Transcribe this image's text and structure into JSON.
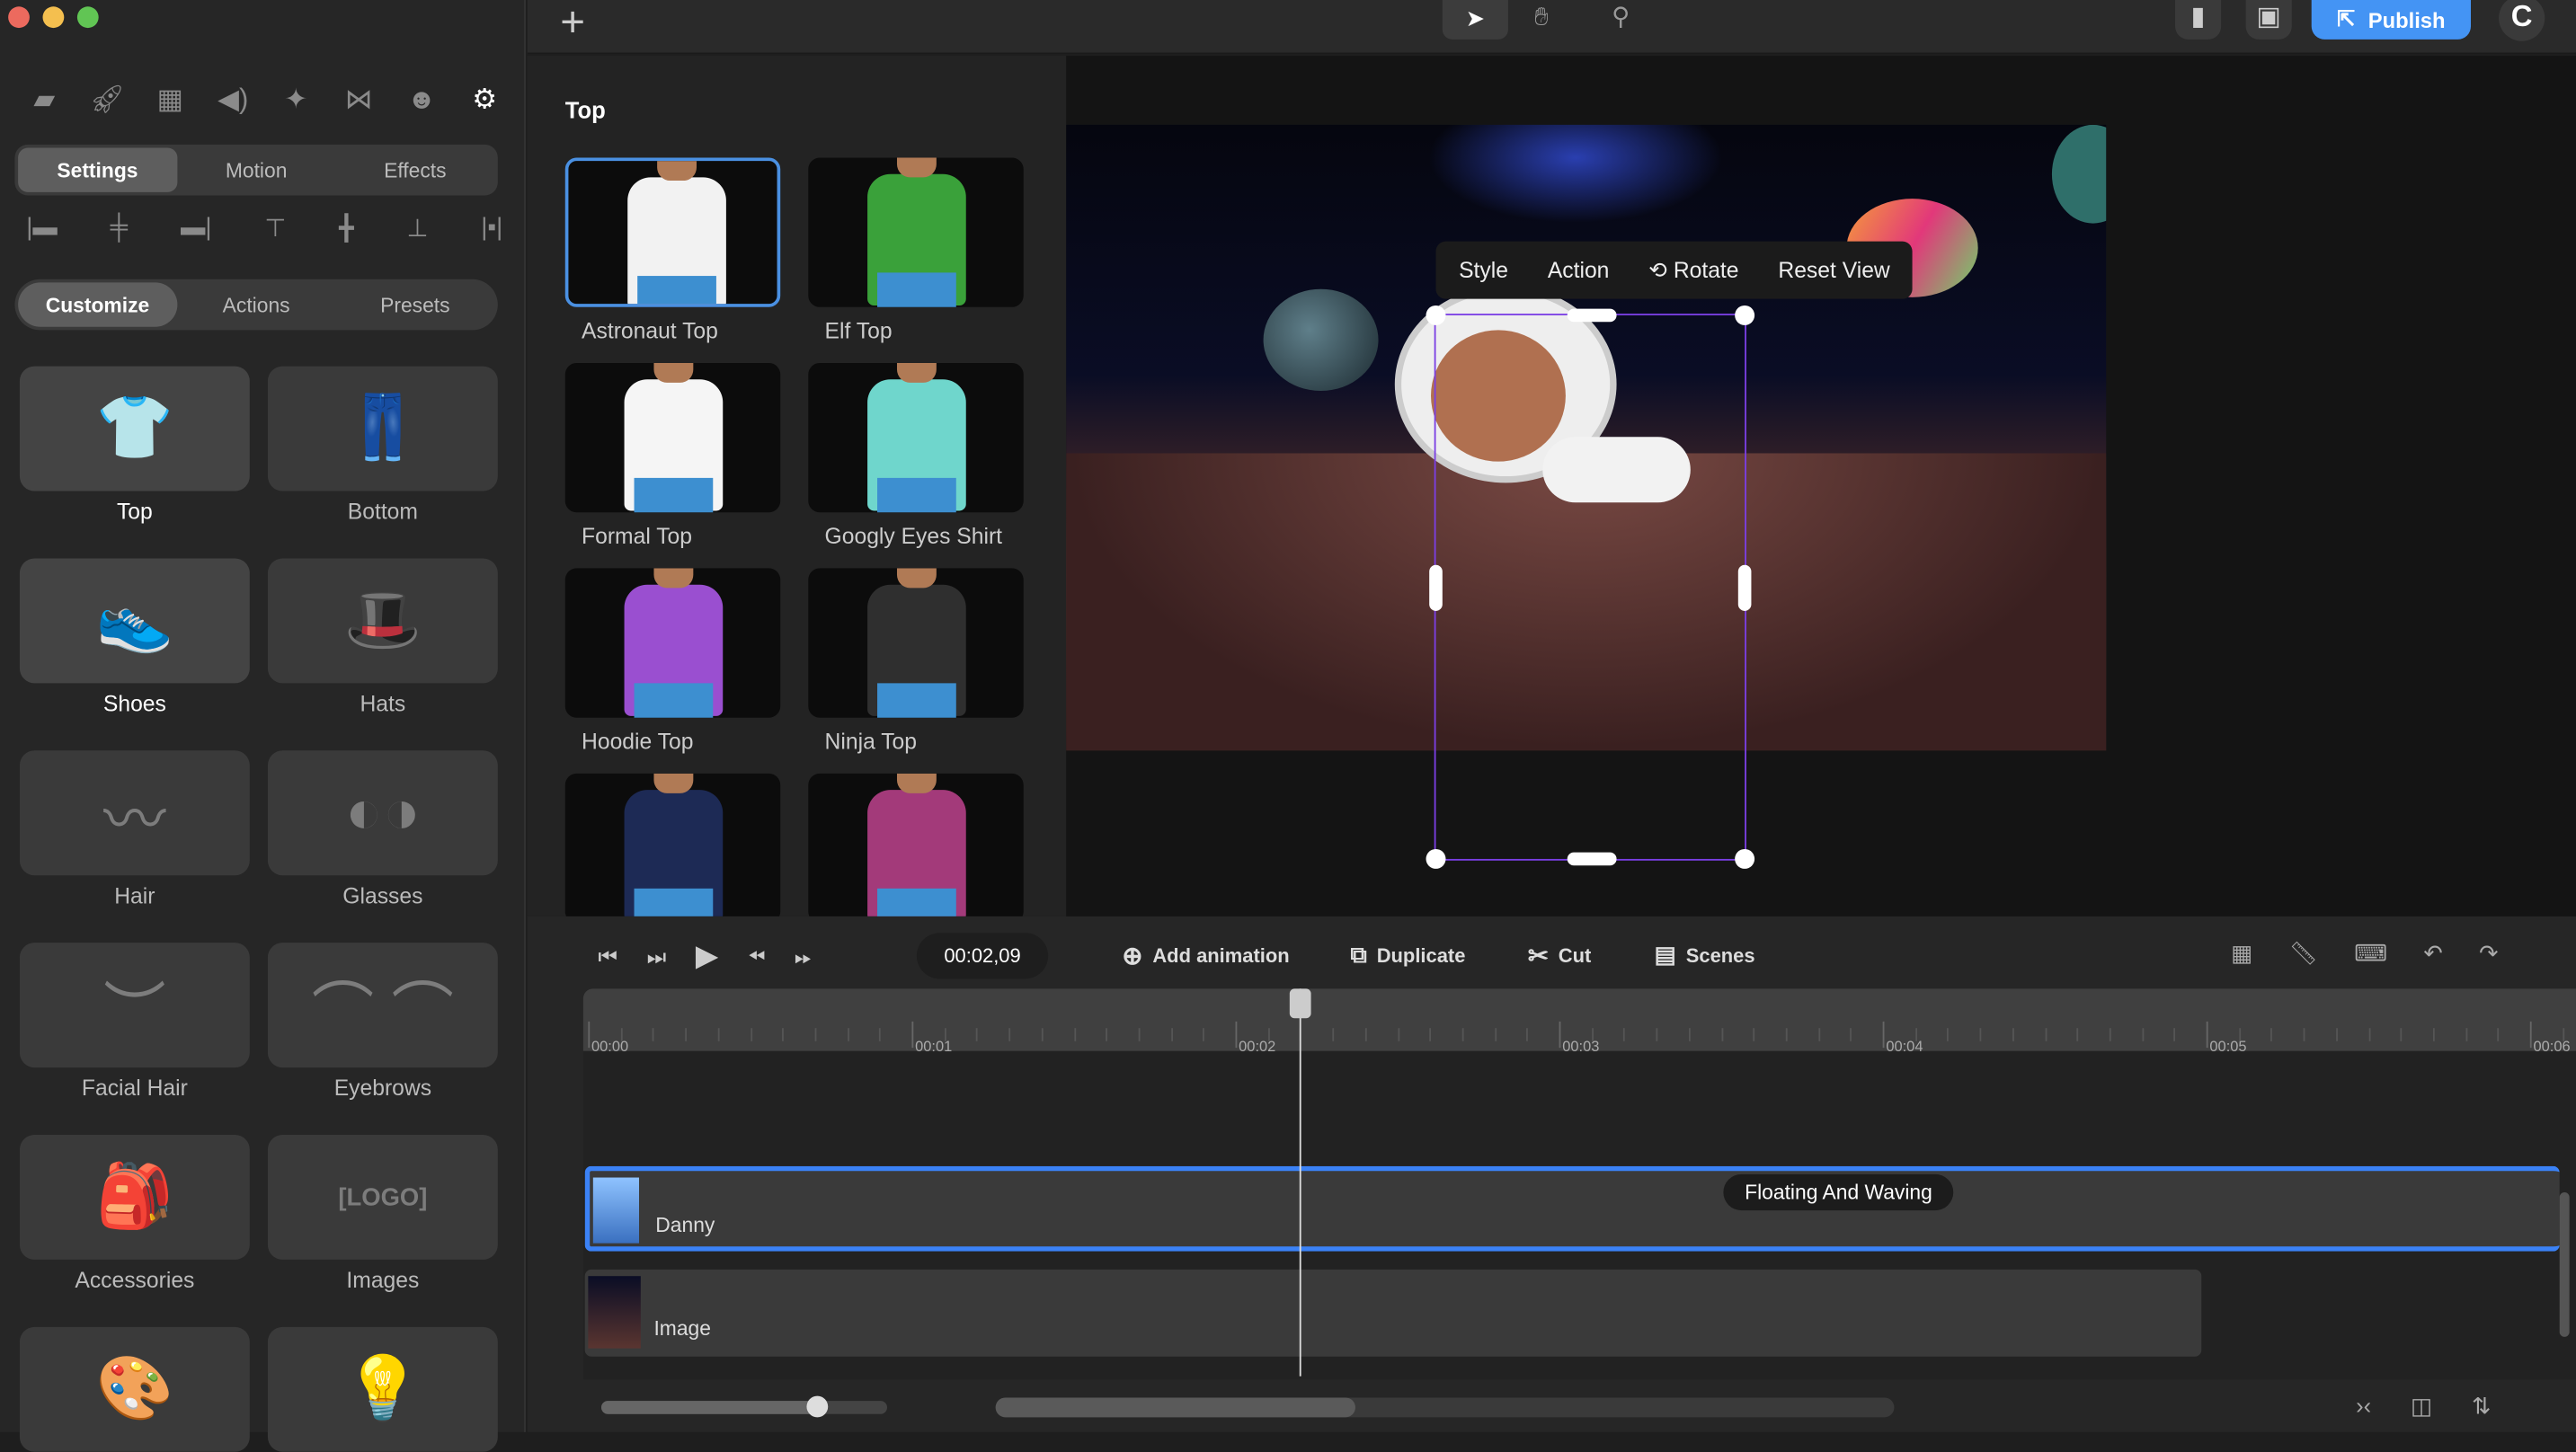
{
  "window": {
    "controls": [
      "close",
      "minimize",
      "maximize"
    ]
  },
  "left_panel": {
    "toolbar_icons": [
      "folder-icon",
      "rocket-icon",
      "layout-icon",
      "speaker-icon",
      "sparkle-icon",
      "bowtie-icon",
      "character-edit-icon",
      "gear-icon"
    ],
    "tabs": [
      "Settings",
      "Motion",
      "Effects"
    ],
    "align_icons": [
      "align-left-icon",
      "align-center-h-icon",
      "align-right-icon",
      "align-top-icon",
      "align-middle-v-icon",
      "align-bottom-icon",
      "distribute-icon"
    ],
    "subtabs": [
      "Customize",
      "Actions",
      "Presets"
    ],
    "categories": [
      {
        "label": "Top",
        "glyph": "👕"
      },
      {
        "label": "Bottom",
        "glyph": "👖"
      },
      {
        "label": "Shoes",
        "glyph": "👟"
      },
      {
        "label": "Hats",
        "glyph": "🎩"
      },
      {
        "label": "Hair",
        "glyph": "〰"
      },
      {
        "label": "Glasses",
        "glyph": "◐◑"
      },
      {
        "label": "Facial Hair",
        "glyph": "︶"
      },
      {
        "label": "Eyebrows",
        "glyph": "⌒ ⌒"
      },
      {
        "label": "Accessories",
        "glyph": "🎒"
      },
      {
        "label": "Images",
        "glyph": "[LOGO]"
      },
      {
        "label": "",
        "glyph": "🎨"
      },
      {
        "label": "",
        "glyph": "💡"
      }
    ]
  },
  "topbar": {
    "add_label": "+",
    "tools": [
      "pointer-icon",
      "hand-icon",
      "search-icon"
    ],
    "publish": "Publish"
  },
  "clothes_panel": {
    "title": "Top",
    "items": [
      {
        "label": "Astronaut Top",
        "color": "#f2f2f2"
      },
      {
        "label": "Elf Top",
        "color": "#3aa13a"
      },
      {
        "label": "Formal Top",
        "color": "#f5f5f5"
      },
      {
        "label": "Googly Eyes Shirt",
        "color": "#6fd6cc"
      },
      {
        "label": "Hoodie Top",
        "color": "#9a4fd0"
      },
      {
        "label": "Ninja Top",
        "color": "#2f2f2f"
      },
      {
        "label": "",
        "color": "#1d2a55"
      },
      {
        "label": "",
        "color": "#a33a7a"
      }
    ]
  },
  "canvas": {
    "context_menu": [
      "Style",
      "Action",
      "Rotate",
      "Reset View"
    ]
  },
  "timeline": {
    "time": "00:02,09",
    "actions": [
      "Add animation",
      "Duplicate",
      "Cut",
      "Scenes"
    ],
    "ticks": [
      "00:00",
      "00:01",
      "00:02",
      "00:03",
      "00:04",
      "00:05",
      "00:06"
    ],
    "playhead_seconds": 2.2,
    "tracks": [
      {
        "label": "Danny",
        "clip": "Floating And Waving"
      },
      {
        "label": "Image"
      }
    ],
    "zoom_fraction": 0.75
  }
}
